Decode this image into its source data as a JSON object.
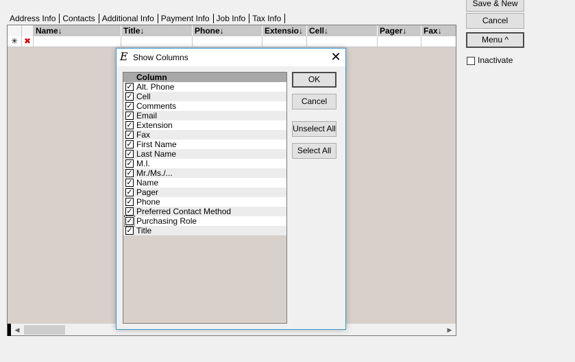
{
  "tabs": [
    {
      "label": "Address Info"
    },
    {
      "label": "Contacts"
    },
    {
      "label": "Additional Info"
    },
    {
      "label": "Payment Info"
    },
    {
      "label": "Job Info"
    },
    {
      "label": "Tax Info"
    }
  ],
  "grid": {
    "columns": [
      "Name",
      "Title",
      "Phone",
      "Extensio",
      "Cell",
      "Pager",
      "Fax"
    ],
    "new_row_symbol": "✳",
    "delete_symbol": "✖"
  },
  "right_panel": {
    "save_new_label": "Save & New",
    "cancel_label": "Cancel",
    "menu_label": "Menu ^",
    "inactivate_label": "Inactivate"
  },
  "dialog": {
    "title": "Show Columns",
    "logo_glyph": "E",
    "close_glyph": "✕",
    "list_header": "Column",
    "columns": [
      {
        "label": "Alt. Phone",
        "checked": true
      },
      {
        "label": "Cell",
        "checked": true
      },
      {
        "label": "Comments",
        "checked": true
      },
      {
        "label": "Email",
        "checked": true
      },
      {
        "label": "Extension",
        "checked": true
      },
      {
        "label": "Fax",
        "checked": true
      },
      {
        "label": "First Name",
        "checked": true
      },
      {
        "label": "Last Name",
        "checked": true
      },
      {
        "label": "M.I.",
        "checked": true
      },
      {
        "label": "Mr./Ms./...",
        "checked": true
      },
      {
        "label": "Name",
        "checked": true
      },
      {
        "label": "Pager",
        "checked": true
      },
      {
        "label": "Phone",
        "checked": true
      },
      {
        "label": "Preferred Contact Method",
        "checked": true
      },
      {
        "label": "Purchasing Role",
        "checked": true
      },
      {
        "label": "Title",
        "checked": true
      }
    ],
    "ok_label": "OK",
    "cancel_label": "Cancel",
    "unselect_all_label": "Unselect All",
    "select_all_label": "Select All"
  }
}
